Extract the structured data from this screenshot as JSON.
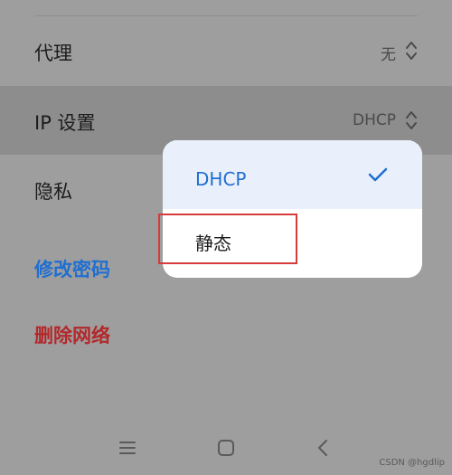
{
  "settings": {
    "proxy": {
      "label": "代理",
      "value": "无"
    },
    "ip_settings": {
      "label": "IP 设置",
      "value": "DHCP"
    },
    "privacy": {
      "label": "隐私"
    },
    "modify_password": "修改密码",
    "delete_network": "删除网络"
  },
  "dropdown": {
    "options": [
      {
        "label": "DHCP",
        "selected": true
      },
      {
        "label": "静态",
        "selected": false
      }
    ]
  },
  "colors": {
    "accent_blue": "#1f6fd1",
    "danger_red": "#b3282b",
    "highlight_box": "#d63a3a"
  },
  "icons": {
    "updown": "updown-chevron-icon",
    "check": "check-icon",
    "nav_menu": "menu-icon",
    "nav_home": "home-icon",
    "nav_back": "back-icon"
  },
  "watermark": "CSDN @hgdlip"
}
